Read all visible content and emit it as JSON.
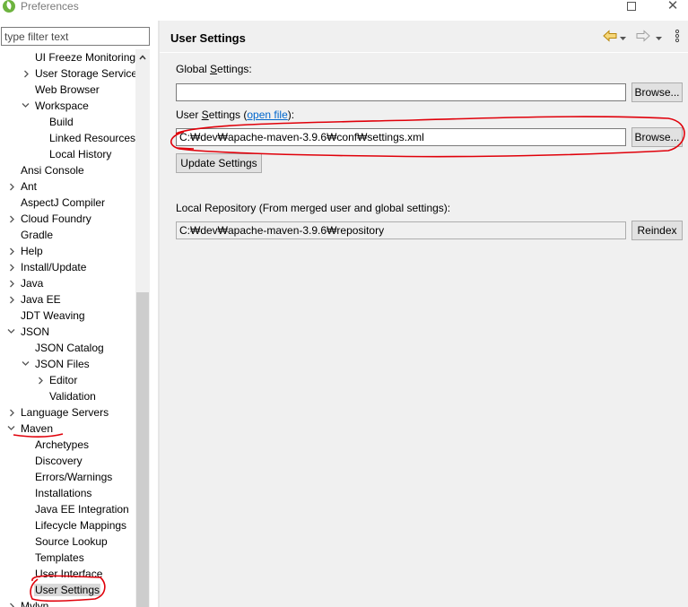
{
  "window": {
    "title": "Preferences"
  },
  "filter": {
    "placeholder": "type filter text"
  },
  "tree": [
    {
      "label": "UI Freeze Monitoring",
      "indent": 2,
      "twisty": "none"
    },
    {
      "label": "User Storage Service",
      "indent": 2,
      "twisty": "collapsed"
    },
    {
      "label": "Web Browser",
      "indent": 2,
      "twisty": "none"
    },
    {
      "label": "Workspace",
      "indent": 2,
      "twisty": "expanded"
    },
    {
      "label": "Build",
      "indent": 3,
      "twisty": "none"
    },
    {
      "label": "Linked Resources",
      "indent": 3,
      "twisty": "none"
    },
    {
      "label": "Local History",
      "indent": 3,
      "twisty": "none"
    },
    {
      "label": "Ansi Console",
      "indent": 1,
      "twisty": "none"
    },
    {
      "label": "Ant",
      "indent": 1,
      "twisty": "collapsed"
    },
    {
      "label": "AspectJ Compiler",
      "indent": 1,
      "twisty": "none"
    },
    {
      "label": "Cloud Foundry",
      "indent": 1,
      "twisty": "collapsed"
    },
    {
      "label": "Gradle",
      "indent": 1,
      "twisty": "none"
    },
    {
      "label": "Help",
      "indent": 1,
      "twisty": "collapsed"
    },
    {
      "label": "Install/Update",
      "indent": 1,
      "twisty": "collapsed"
    },
    {
      "label": "Java",
      "indent": 1,
      "twisty": "collapsed"
    },
    {
      "label": "Java EE",
      "indent": 1,
      "twisty": "collapsed"
    },
    {
      "label": "JDT Weaving",
      "indent": 1,
      "twisty": "none"
    },
    {
      "label": "JSON",
      "indent": 1,
      "twisty": "expanded"
    },
    {
      "label": "JSON Catalog",
      "indent": 2,
      "twisty": "none"
    },
    {
      "label": "JSON Files",
      "indent": 2,
      "twisty": "expanded"
    },
    {
      "label": "Editor",
      "indent": 3,
      "twisty": "collapsed"
    },
    {
      "label": "Validation",
      "indent": 3,
      "twisty": "none"
    },
    {
      "label": "Language Servers",
      "indent": 1,
      "twisty": "collapsed"
    },
    {
      "label": "Maven",
      "indent": 1,
      "twisty": "expanded"
    },
    {
      "label": "Archetypes",
      "indent": 2,
      "twisty": "none"
    },
    {
      "label": "Discovery",
      "indent": 2,
      "twisty": "none"
    },
    {
      "label": "Errors/Warnings",
      "indent": 2,
      "twisty": "none"
    },
    {
      "label": "Installations",
      "indent": 2,
      "twisty": "none"
    },
    {
      "label": "Java EE Integration",
      "indent": 2,
      "twisty": "none"
    },
    {
      "label": "Lifecycle Mappings",
      "indent": 2,
      "twisty": "none"
    },
    {
      "label": "Source Lookup",
      "indent": 2,
      "twisty": "none"
    },
    {
      "label": "Templates",
      "indent": 2,
      "twisty": "none"
    },
    {
      "label": "User Interface",
      "indent": 2,
      "twisty": "none"
    },
    {
      "label": "User Settings",
      "indent": 2,
      "twisty": "none",
      "selected": true
    },
    {
      "label": "Mylyn",
      "indent": 1,
      "twisty": "collapsed"
    }
  ],
  "page": {
    "title": "User Settings",
    "global_settings": {
      "label_pre": "Global ",
      "label_mn": "S",
      "label_post": "ettings:",
      "value": "",
      "browse": "Browse..."
    },
    "user_settings": {
      "label_pre": "User ",
      "label_mn": "S",
      "label_post": "ettings (",
      "link": "open file",
      "label_end": "):",
      "value": "C:₩dev₩apache-maven-3.9.6₩conf₩settings.xml",
      "browse": "Browse..."
    },
    "update_button": "Update Settings",
    "local_repo": {
      "label": "Local Repository (From merged user and global settings):",
      "value": "C:₩dev₩apache-maven-3.9.6₩repository",
      "reindex": "Reindex"
    }
  },
  "colors": {
    "annotation": "#e0000a",
    "selection": "#d9d9d9",
    "link": "#0066cc"
  }
}
